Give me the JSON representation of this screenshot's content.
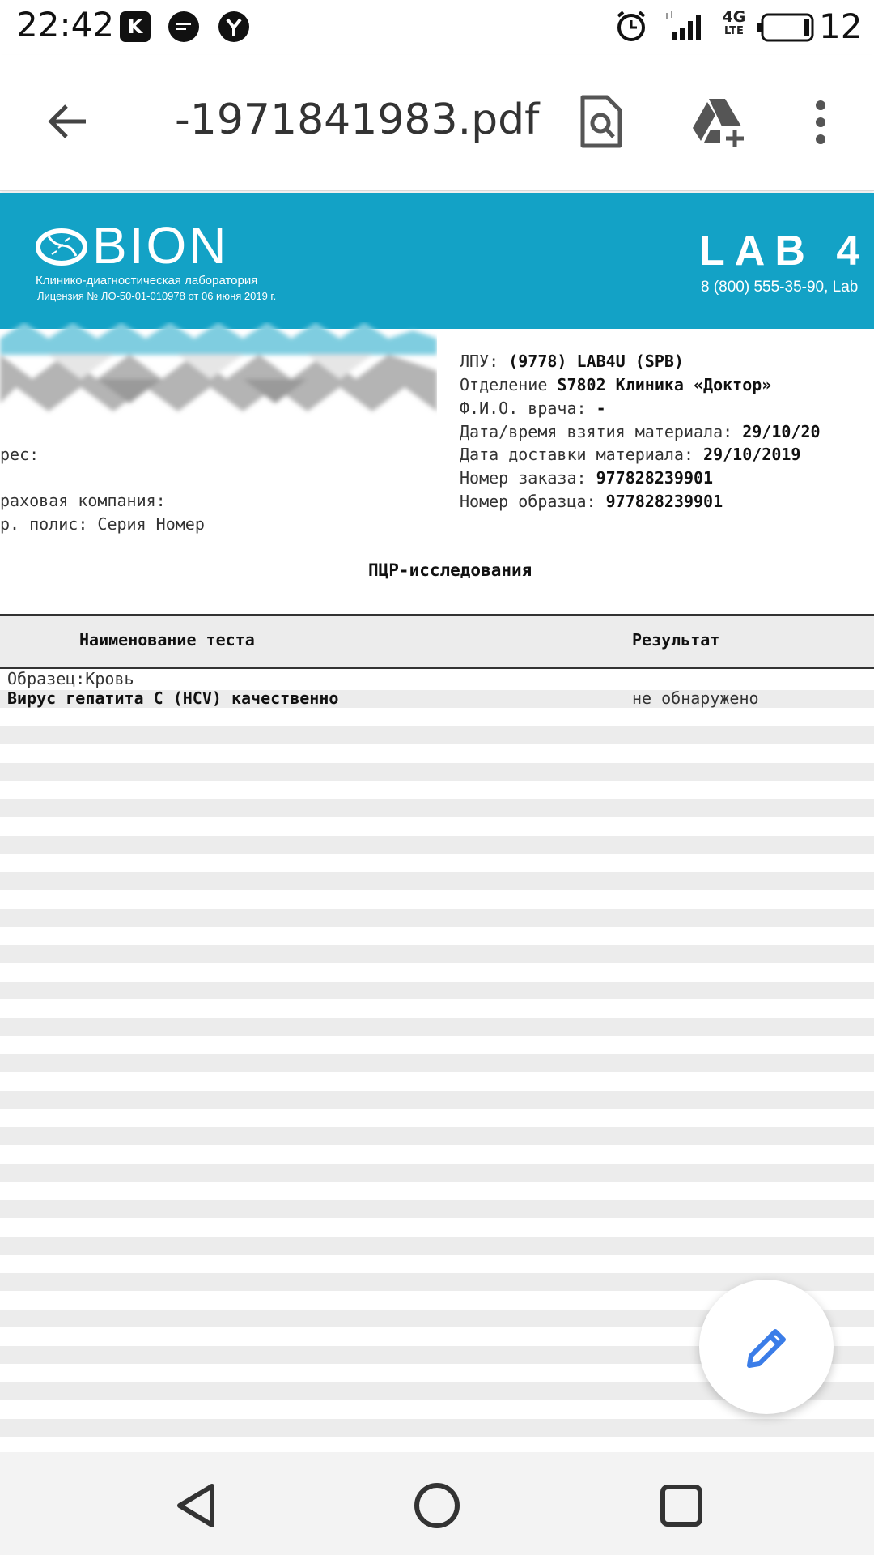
{
  "status_bar": {
    "time": "22:42",
    "notification_icons": [
      "kinopoisk-icon",
      "chat-icon",
      "yandex-browser-icon"
    ],
    "system_icons": [
      "alarm-icon",
      "signal-icon",
      "lte-icon",
      "battery-icon"
    ],
    "network": "4G",
    "network_sub": "LTE",
    "battery": "12"
  },
  "toolbar": {
    "title": "-1971841983.pdf",
    "icons": [
      "back-arrow-icon",
      "find-in-page-icon",
      "save-to-drive-icon",
      "more-vert-icon"
    ]
  },
  "pdf": {
    "logo_text": "BION",
    "logo_sub1": "Клинико-диагностическая лаборатория",
    "logo_sub2": "Лицензия № ЛО-50-01-010978 от 06 июня 2019 г.",
    "partner": "LAB 4",
    "partner_phone": "8 (800) 555-35-90, Lab",
    "info": {
      "lpu_label": "ЛПУ:",
      "lpu_value": "(9778) LAB4U (SPB)",
      "dept_label": "Отделение",
      "dept_value": "S7802 Клиника «Доктор»",
      "doctor_label": "Ф.И.О. врача:",
      "doctor_value": "-",
      "taken_label": "Дата/время взятия материала:",
      "taken_value": "29/10/20",
      "delivered_label": "Дата доставки материала:",
      "delivered_value": "29/10/2019",
      "order_label": "Номер заказа:",
      "order_value": "977828239901",
      "sample_label": "Номер образца:",
      "sample_value": "977828239901"
    },
    "left_info": {
      "address": "рес:",
      "insurance": "раховая компания:",
      "policy": "р. полис: Серия  Номер"
    },
    "section_title": "ПЦР-исследования",
    "table": {
      "col_test": "Наименование теста",
      "col_result": "Результат",
      "sample_row": "Образец:Кровь",
      "rows": [
        {
          "test": "Вирус гепатита С (HCV) качественно",
          "result": "не обнаружено"
        }
      ]
    }
  },
  "fab": {
    "icon": "edit-pencil-icon",
    "color": "#3b7de8"
  },
  "nav_bar": {
    "icons": [
      "nav-back-icon",
      "nav-home-icon",
      "nav-recents-icon"
    ]
  },
  "colors": {
    "banner": "#13a2c6",
    "stripe": "#ececec"
  }
}
